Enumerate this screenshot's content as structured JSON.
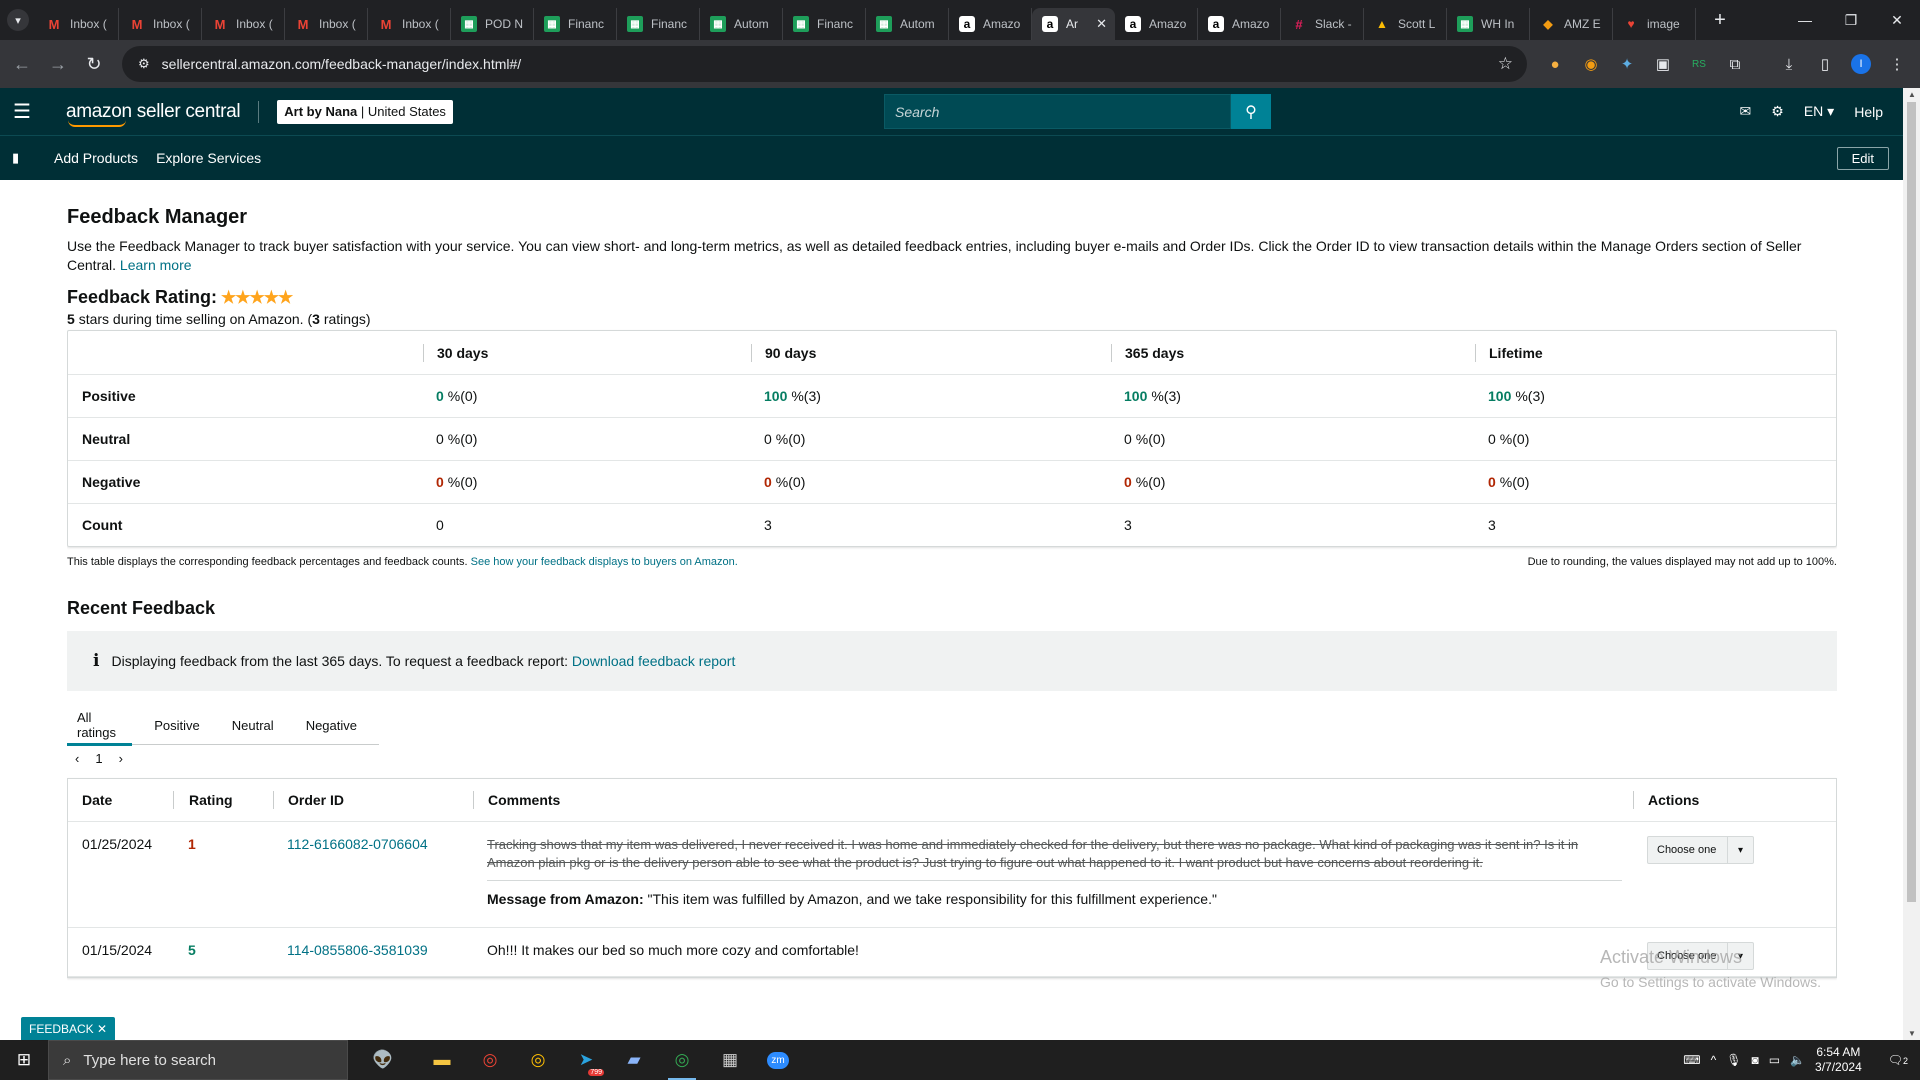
{
  "browser": {
    "tabs": [
      {
        "icon": "gmail-icon",
        "label": "Inbox (",
        "active": false
      },
      {
        "icon": "gmail-icon",
        "label": "Inbox (",
        "active": false
      },
      {
        "icon": "gmail-icon",
        "label": "Inbox (",
        "active": false
      },
      {
        "icon": "gmail-icon",
        "label": "Inbox (",
        "active": false
      },
      {
        "icon": "gmail-icon",
        "label": "Inbox (",
        "active": false
      },
      {
        "icon": "sheets-icon",
        "label": "POD N",
        "active": false
      },
      {
        "icon": "sheets-icon",
        "label": "Financ",
        "active": false
      },
      {
        "icon": "sheets-icon",
        "label": "Financ",
        "active": false
      },
      {
        "icon": "sheets-icon",
        "label": "Autom",
        "active": false
      },
      {
        "icon": "sheets-icon",
        "label": "Financ",
        "active": false
      },
      {
        "icon": "sheets-icon",
        "label": "Autom",
        "active": false
      },
      {
        "icon": "amazon-icon",
        "label": "Amazo",
        "active": false
      },
      {
        "icon": "amazon-icon",
        "label": "Ar",
        "active": true
      },
      {
        "icon": "amazon-icon",
        "label": "Amazo",
        "active": false
      },
      {
        "icon": "amazon-icon",
        "label": "Amazo",
        "active": false
      },
      {
        "icon": "slack-icon",
        "label": "Slack -",
        "active": false
      },
      {
        "icon": "drive-icon",
        "label": "Scott L",
        "active": false
      },
      {
        "icon": "sheets-icon",
        "label": "WH In",
        "active": false
      },
      {
        "icon": "amz-ext-icon",
        "label": "AMZ E",
        "active": false
      },
      {
        "icon": "image-tab-icon",
        "label": "image",
        "active": false
      }
    ],
    "url": "sellercentral.amazon.com/feedback-manager/index.html#/",
    "profile_initial": "I"
  },
  "header": {
    "logo": "amazon seller central",
    "store_name": "Art by Nana",
    "store_region": "United States",
    "search_placeholder": "Search",
    "language": "EN",
    "help": "Help",
    "nav_links": [
      "Add Products",
      "Explore Services"
    ],
    "edit": "Edit"
  },
  "page": {
    "title": "Feedback Manager",
    "intro": "Use the Feedback Manager to track buyer satisfaction with your service. You can view short- and long-term metrics, as well as detailed feedback entries, including buyer e-mails and Order IDs. Click the Order ID to view transaction details within the Manage Orders section of Seller Central.",
    "learn_more": "Learn more",
    "rating_label": "Feedback Rating:",
    "rating_stars": 5,
    "rating_sub_stars": "5",
    "rating_sub_text": "stars during time selling on Amazon. (",
    "rating_sub_count": "3",
    "rating_sub_end": "ratings)",
    "metrics": {
      "columns": [
        "30 days",
        "90 days",
        "365 days",
        "Lifetime"
      ],
      "rows": [
        {
          "label": "Positive",
          "kind": "pos",
          "values": [
            {
              "pct": "0",
              "count": "%(0)"
            },
            {
              "pct": "100",
              "count": "%(3)"
            },
            {
              "pct": "100",
              "count": "%(3)"
            },
            {
              "pct": "100",
              "count": "%(3)"
            }
          ]
        },
        {
          "label": "Neutral",
          "kind": "zero",
          "values": [
            {
              "pct": "0",
              "count": "%(0)"
            },
            {
              "pct": "0",
              "count": "%(0)"
            },
            {
              "pct": "0",
              "count": "%(0)"
            },
            {
              "pct": "0",
              "count": "%(0)"
            }
          ]
        },
        {
          "label": "Negative",
          "kind": "neg",
          "values": [
            {
              "pct": "0",
              "count": "%(0)"
            },
            {
              "pct": "0",
              "count": "%(0)"
            },
            {
              "pct": "0",
              "count": "%(0)"
            },
            {
              "pct": "0",
              "count": "%(0)"
            }
          ]
        },
        {
          "label": "Count",
          "kind": "plain",
          "values": [
            {
              "pct": "0",
              "count": ""
            },
            {
              "pct": "3",
              "count": ""
            },
            {
              "pct": "3",
              "count": ""
            },
            {
              "pct": "3",
              "count": ""
            }
          ]
        }
      ]
    },
    "table_note": "This table displays the corresponding feedback percentages and feedback counts.",
    "table_note_link": "See how your feedback displays to buyers on Amazon.",
    "rounding_note": "Due to rounding, the values displayed may not add up to 100%.",
    "recent_title": "Recent Feedback",
    "alert_text": "Displaying feedback from the last 365 days. To request a feedback report:",
    "alert_link": "Download feedback report",
    "filter_tabs": [
      "All ratings",
      "Positive",
      "Neutral",
      "Negative"
    ],
    "page_number": "1",
    "feedback_columns": [
      "Date",
      "Rating",
      "Order ID",
      "Comments",
      "Actions"
    ],
    "feedback": [
      {
        "date": "01/25/2024",
        "rating": "1",
        "order_id": "112-6166082-0706604",
        "comment": "Tracking shows that my item was delivered, I never received it. I was home and immediately checked for the delivery, but there was no package. What kind of packaging was it sent in? Is it in Amazon plain pkg or is the delivery person able to see what the product is? Just trying to figure out what happened to it. I want product but have concerns about reordering it.",
        "amazon_label": "Message from Amazon:",
        "amazon_message": "\"This item was fulfilled by Amazon, and we take responsibility for this fulfillment experience.\"",
        "action": "Choose one"
      },
      {
        "date": "01/15/2024",
        "rating": "5",
        "order_id": "114-0855806-3581039",
        "comment": "Oh!!! It makes our bed so much more cozy and comfortable!",
        "action": "Choose one"
      }
    ],
    "feedback_tab": "FEEDBACK"
  },
  "os": {
    "watermark_title": "Activate Windows",
    "watermark_sub": "Go to Settings to activate Windows.",
    "search_placeholder": "Type here to search",
    "time": "6:54 AM",
    "date": "3/7/2024",
    "notification_count": "2",
    "telegram_badge": "799"
  },
  "colors": {
    "header": "#002f36",
    "accent": "#008296",
    "positive": "#067d62",
    "negative": "#b12704",
    "link": "#007185"
  }
}
